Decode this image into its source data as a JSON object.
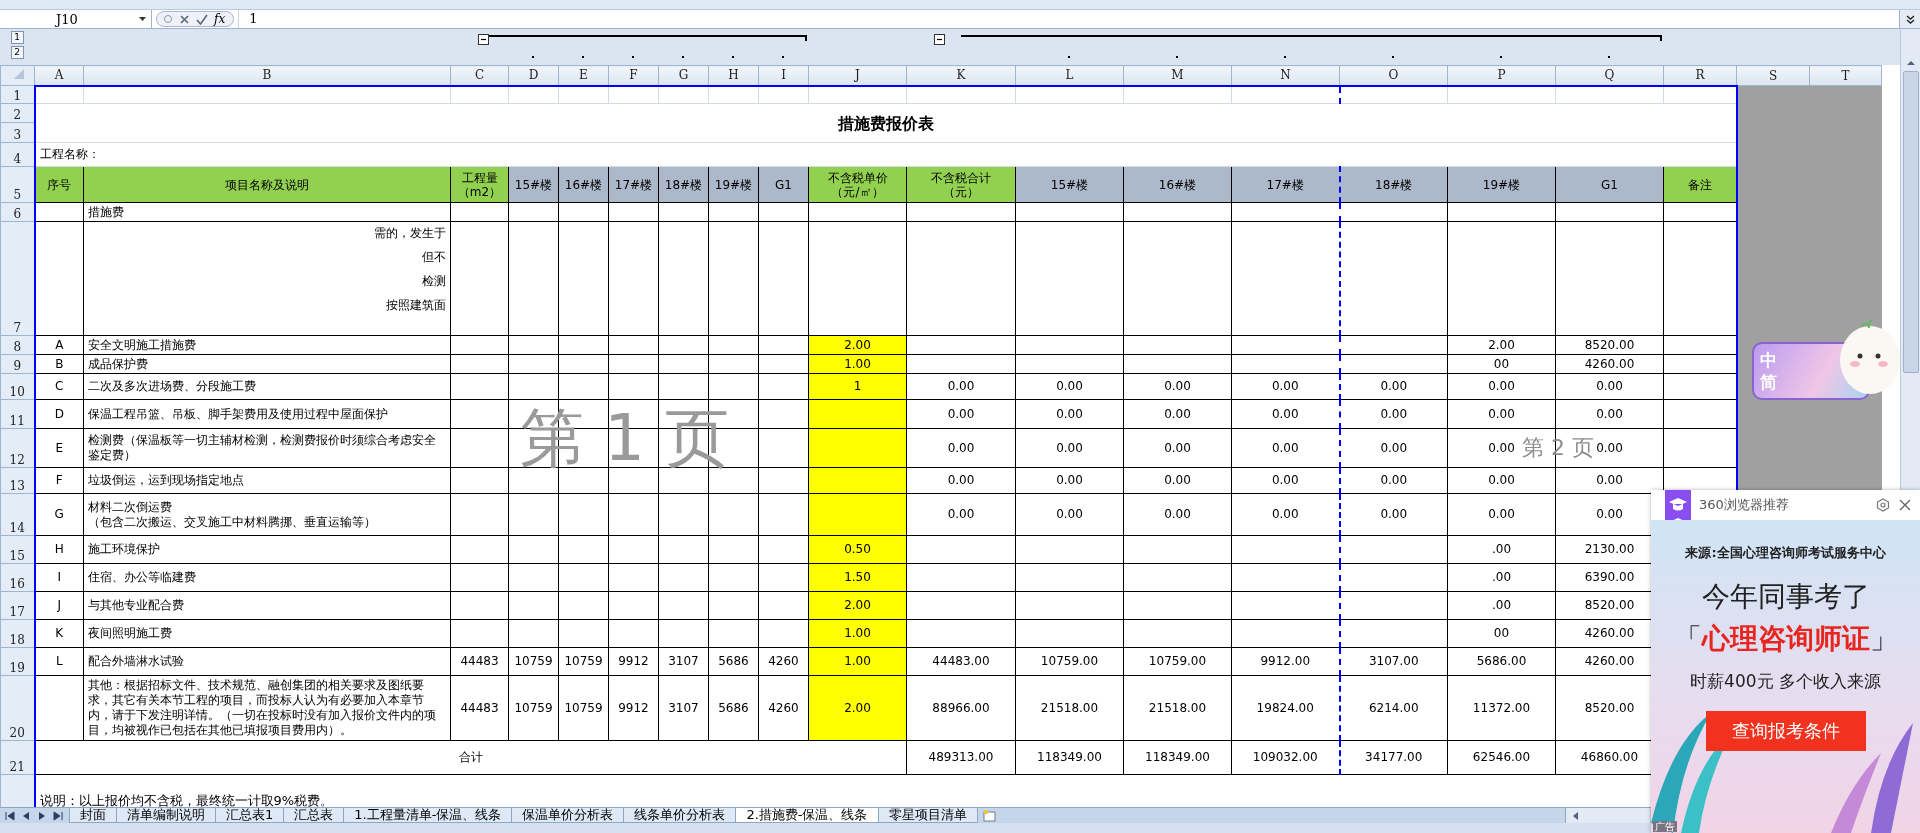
{
  "formula_bar": {
    "name_box": "J10",
    "fx": "fx",
    "value": "1"
  },
  "outline": {
    "levels": [
      "1",
      "2"
    ]
  },
  "sheet": {
    "columns": [
      {
        "label": "A",
        "grouped": false
      },
      {
        "label": "B",
        "grouped": false
      },
      {
        "label": "C",
        "grouped": false,
        "expanded": true
      },
      {
        "label": "D",
        "grouped": true
      },
      {
        "label": "E",
        "grouped": true
      },
      {
        "label": "F",
        "grouped": true
      },
      {
        "label": "G",
        "grouped": true
      },
      {
        "label": "H",
        "grouped": true
      },
      {
        "label": "I",
        "grouped": true
      },
      {
        "label": "J",
        "grouped": false,
        "highlight": true
      },
      {
        "label": "K",
        "grouped": false,
        "expanded": true
      },
      {
        "label": "L",
        "grouped": true
      },
      {
        "label": "M",
        "grouped": true
      },
      {
        "label": "N",
        "grouped": true,
        "page_break": true
      },
      {
        "label": "O",
        "grouped": true
      },
      {
        "label": "P",
        "grouped": true
      },
      {
        "label": "Q",
        "grouped": true
      },
      {
        "label": "R"
      },
      {
        "label": "S",
        "outside": true
      },
      {
        "label": "T",
        "outside": true
      }
    ],
    "rows": [
      {
        "num": "1",
        "kind": "blank"
      },
      {
        "num": "2",
        "kind": "title",
        "title": "措施费报价表"
      },
      {
        "num": "3",
        "kind": "merged"
      },
      {
        "num": "4",
        "kind": "line",
        "project_label": "工程名称："
      },
      {
        "num": "5",
        "kind": "header",
        "cells": [
          {
            "lines": [
              "序号"
            ],
            "color": "#92d050"
          },
          {
            "lines": [
              "项目名称及说明"
            ],
            "color": "#92d050"
          },
          {
            "lines": [
              "工程量",
              "（m2）"
            ],
            "color": "#92d050"
          },
          {
            "lines": [
              "15#楼"
            ],
            "color": "#acb9ca"
          },
          {
            "lines": [
              "16#楼"
            ],
            "color": "#acb9ca"
          },
          {
            "lines": [
              "17#楼"
            ],
            "color": "#acb9ca"
          },
          {
            "lines": [
              "18#楼"
            ],
            "color": "#acb9ca"
          },
          {
            "lines": [
              "19#楼"
            ],
            "color": "#acb9ca"
          },
          {
            "lines": [
              "G1"
            ],
            "color": "#acb9ca"
          },
          {
            "lines": [
              "不含税单价",
              "（元/㎡）"
            ],
            "color": "#92d050"
          },
          {
            "lines": [
              "不含税合计",
              "（元）"
            ],
            "color": "#92d050"
          },
          {
            "lines": [
              "15#楼"
            ],
            "color": "#acb9ca"
          },
          {
            "lines": [
              "16#楼"
            ],
            "color": "#acb9ca"
          },
          {
            "lines": [
              "17#楼"
            ],
            "color": "#acb9ca"
          },
          {
            "lines": [
              "18#楼"
            ],
            "color": "#acb9ca"
          },
          {
            "lines": [
              "19#楼"
            ],
            "color": "#acb9ca"
          },
          {
            "lines": [
              "G1"
            ],
            "color": "#acb9ca"
          },
          {
            "lines": [
              "备注"
            ],
            "color": "#92d050"
          }
        ]
      },
      {
        "num": "6",
        "kind": "data",
        "cells": {
          "B": "措施费"
        }
      },
      {
        "num": "7",
        "kind": "covered",
        "cells": {
          "B": [
            "需的，发生于",
            "但不",
            "检测",
            "按照建筑面"
          ]
        }
      },
      {
        "num": "8",
        "kind": "data",
        "highlighted": true,
        "cells": {
          "A": "A",
          "B": "安全文明施工措施费",
          "J": "2.00",
          "P": "2.00",
          "Q": "8520.00"
        }
      },
      {
        "num": "9",
        "kind": "data",
        "highlighted": true,
        "cells": {
          "A": "B",
          "B": "成品保护费",
          "J": "1.00",
          "P": "00",
          "Q": "4260.00"
        }
      },
      {
        "num": "10",
        "kind": "data",
        "highlighted": true,
        "cells": {
          "A": "C",
          "B": "二次及多次进场费、分段施工费",
          "J": "1",
          "K": "0.00",
          "L": "0.00",
          "M": "0.00",
          "N": "0.00",
          "O": "0.00",
          "P": "0.00",
          "Q": "0.00"
        }
      },
      {
        "num": "11",
        "kind": "data",
        "highlighted": true,
        "cells": {
          "A": "D",
          "B": "保温工程吊篮、吊板、脚手架费用及使用过程中屋面保护",
          "K": "0.00",
          "L": "0.00",
          "M": "0.00",
          "N": "0.00",
          "O": "0.00",
          "P": "0.00",
          "Q": "0.00"
        }
      },
      {
        "num": "12",
        "kind": "data",
        "highlighted": true,
        "cells": {
          "A": "E",
          "B": "检测费（保温板等一切主辅材检测，检测费报价时须综合考虑安全鉴定费）",
          "K": "0.00",
          "L": "0.00",
          "M": "0.00",
          "N": "0.00",
          "O": "0.00",
          "P": "0.00",
          "Q": "0.00"
        }
      },
      {
        "num": "13",
        "kind": "data",
        "highlighted": true,
        "cells": {
          "A": "F",
          "B": "垃圾倒运，运到现场指定地点",
          "K": "0.00",
          "L": "0.00",
          "M": "0.00",
          "N": "0.00",
          "O": "0.00",
          "P": "0.00",
          "Q": "0.00"
        }
      },
      {
        "num": "14",
        "kind": "data",
        "highlighted": true,
        "cells": {
          "A": "G",
          "B": [
            "材料二次倒运费",
            "（包含二次搬运、交叉施工中材料腾挪、垂直运输等）"
          ],
          "K": "0.00",
          "L": "0.00",
          "M": "0.00",
          "N": "0.00",
          "O": "0.00",
          "P": "0.00",
          "Q": "0.00"
        }
      },
      {
        "num": "15",
        "kind": "data",
        "highlighted": true,
        "cells": {
          "A": "H",
          "B": "施工环境保护",
          "J": "0.50",
          "P": ".00",
          "Q": "2130.00"
        }
      },
      {
        "num": "16",
        "kind": "data",
        "highlighted": true,
        "cells": {
          "A": "I",
          "B": "住宿、办公等临建费",
          "J": "1.50",
          "P": ".00",
          "Q": "6390.00"
        }
      },
      {
        "num": "17",
        "kind": "data",
        "highlighted": true,
        "cells": {
          "A": "J",
          "B": "与其他专业配合费",
          "J": "2.00",
          "P": ".00",
          "Q": "8520.00"
        }
      },
      {
        "num": "18",
        "kind": "data",
        "highlighted": true,
        "cells": {
          "A": "K",
          "B": "夜间照明施工费",
          "J": "1.00",
          "P": "00",
          "Q": "4260.00"
        }
      },
      {
        "num": "19",
        "kind": "data",
        "highlighted": true,
        "cells": {
          "A": "L",
          "B": "配合外墙淋水试验",
          "C": "44483",
          "D": "10759",
          "E": "10759",
          "F": "9912",
          "G": "3107",
          "H": "5686",
          "I": "4260",
          "J": "1.00",
          "K": "44483.00",
          "L": "10759.00",
          "M": "10759.00",
          "N": "9912.00",
          "O": "3107.00",
          "P": "5686.00",
          "Q": "4260.00"
        }
      },
      {
        "num": "20",
        "kind": "data",
        "highlighted": true,
        "cells": {
          "B": "其他：根据招标文件、技术规范、融创集团的相关要求及图纸要求，其它有关本节工程的项目，而投标人认为有必要加入本章节内，请于下发注明详情。（一切在投标时没有加入报价文件内的项目，均被视作已包括在其他已填报项目费用内）。",
          "C": "44483",
          "D": "10759",
          "E": "10759",
          "F": "9912",
          "G": "3107",
          "H": "5686",
          "I": "4260",
          "J": "2.00",
          "K": "88966.00",
          "L": "21518.00",
          "M": "21518.00",
          "N": "19824.00",
          "O": "6214.00",
          "P": "11372.00",
          "Q": "8520.00"
        }
      },
      {
        "num": "21",
        "kind": "total",
        "total_label": "合计",
        "cells": {
          "K": "489313.00",
          "L": "118349.00",
          "M": "118349.00",
          "N": "109032.00",
          "O": "34177.00",
          "P": "62546.00",
          "Q": "46860.00"
        }
      },
      {
        "kind": "note",
        "note": "说明：以上报价均不含税，最终统一计取9%税费。"
      }
    ]
  },
  "page_labels": [
    "第 1 页",
    "第 2 页"
  ],
  "sheet_tabs": [
    {
      "label": "封面",
      "selected": false
    },
    {
      "label": "清单编制说明",
      "selected": false
    },
    {
      "label": "汇总表1",
      "selected": false
    },
    {
      "label": "汇总表",
      "selected": false
    },
    {
      "label": "1.工程量清单-保温、线条",
      "selected": false
    },
    {
      "label": "保温单价分析表",
      "selected": false
    },
    {
      "label": "线条单价分析表",
      "selected": false
    },
    {
      "label": "2.措施费-保温、线条",
      "selected": true
    },
    {
      "label": "零星项目清单",
      "selected": false
    }
  ],
  "ime": {
    "mode": "中",
    "script": "简"
  },
  "ad": {
    "source": "360浏览器推荐",
    "from": "来源:全国心理咨询师考试服务中心",
    "headline": "今年同事考了",
    "open": "「",
    "highlight": "心理咨询师证",
    "close": "」",
    "subline": "时薪400元  多个收入来源",
    "button": "查询报考条件",
    "tag": "广告"
  }
}
